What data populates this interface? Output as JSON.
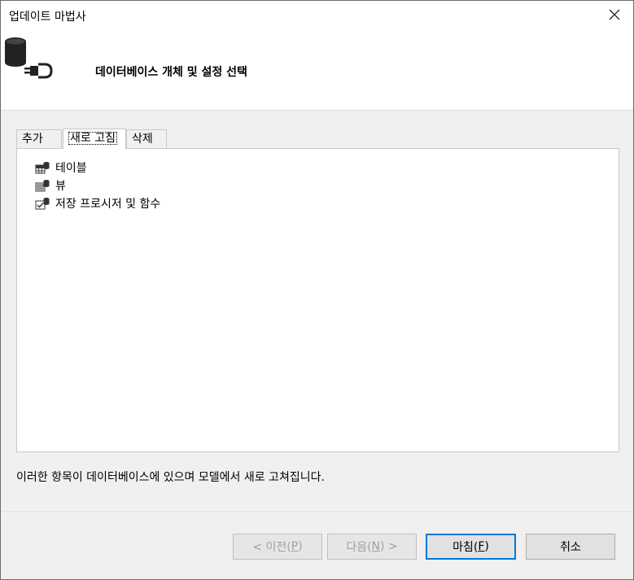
{
  "window": {
    "title": "업데이트 마법사"
  },
  "header": {
    "title": "데이터베이스 개체 및 설정 선택"
  },
  "tabs": [
    {
      "label": "추가",
      "selected": false
    },
    {
      "label": "새로 고침",
      "selected": true
    },
    {
      "label": "삭제",
      "selected": false
    }
  ],
  "tree": {
    "items": [
      {
        "label": "테이블",
        "icon": "table-icon"
      },
      {
        "label": "뷰",
        "icon": "view-icon"
      },
      {
        "label": "저장 프로시저 및 함수",
        "icon": "stored-procedure-icon"
      }
    ]
  },
  "description": "이러한 항목이 데이터베이스에 있으며 모델에서 새로 고쳐집니다.",
  "buttons": {
    "prev": {
      "prefix": "< 이전(",
      "key": "P",
      "suffix": ")"
    },
    "next": {
      "prefix": "다음(",
      "key": "N",
      "suffix": ") >"
    },
    "finish": {
      "prefix": "마침(",
      "key": "F",
      "suffix": ")"
    },
    "cancel": "취소"
  },
  "colors": {
    "default_button_border": "#0078d7",
    "window_background": "#f0f0f0"
  }
}
